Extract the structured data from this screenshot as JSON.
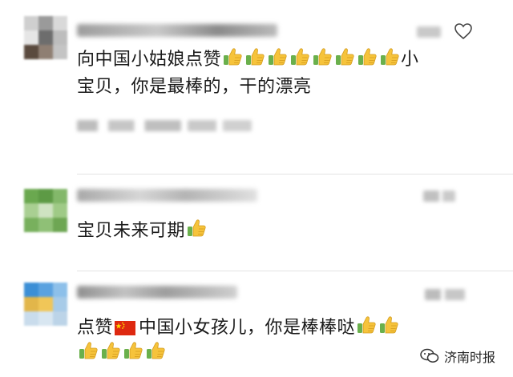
{
  "comments": [
    {
      "line1": "向中国小姑娘点赞",
      "line1_tail": "小",
      "line2": "宝贝，你是最棒的，干的漂亮",
      "thumbs_line1": 8
    },
    {
      "line1": "宝贝未来可期",
      "thumbs_line1": 1
    },
    {
      "line1_a": "点赞",
      "line1_b": "中国小女孩儿，你是棒棒哒",
      "thumbs_line1": 2,
      "thumbs_line2": 4
    }
  ],
  "watermark": {
    "text": "济南时报"
  },
  "icons": {
    "like": "heart-outline-icon",
    "emoji": "thumbs-up-icon",
    "flag": "china-flag-icon"
  },
  "colors": {
    "thumb_yellow": "#f6c33b",
    "thumb_green": "#6ab04c",
    "text": "#1a1a1a",
    "divider": "#e3e3e3"
  }
}
